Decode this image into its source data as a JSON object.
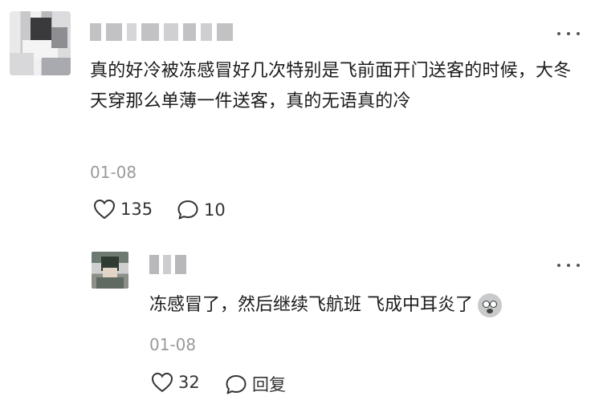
{
  "main_comment": {
    "text": "真的好冷被冻感冒好几次特别是飞前面开门送客的时候，大冬天穿那么单薄一件送客，真的无语真的冷",
    "date": "01-08",
    "like_count": "135",
    "reply_count": "10",
    "icons": {
      "avatar": "avatar",
      "more": "more-icon",
      "like": "heart-icon",
      "comment": "comment-bubble-icon"
    }
  },
  "reply": {
    "text": "冻感冒了，然后继续飞航班 飞成中耳炎了",
    "date": "01-08",
    "like_count": "32",
    "reply_label": "回复",
    "icons": {
      "avatar": "avatar",
      "more": "more-icon",
      "emoji": "worried-face-emoji",
      "like": "heart-icon",
      "comment": "comment-bubble-icon"
    }
  },
  "colors": {
    "text": "#1b1b1b",
    "meta": "#9a9a9a",
    "icon": "#333333"
  }
}
